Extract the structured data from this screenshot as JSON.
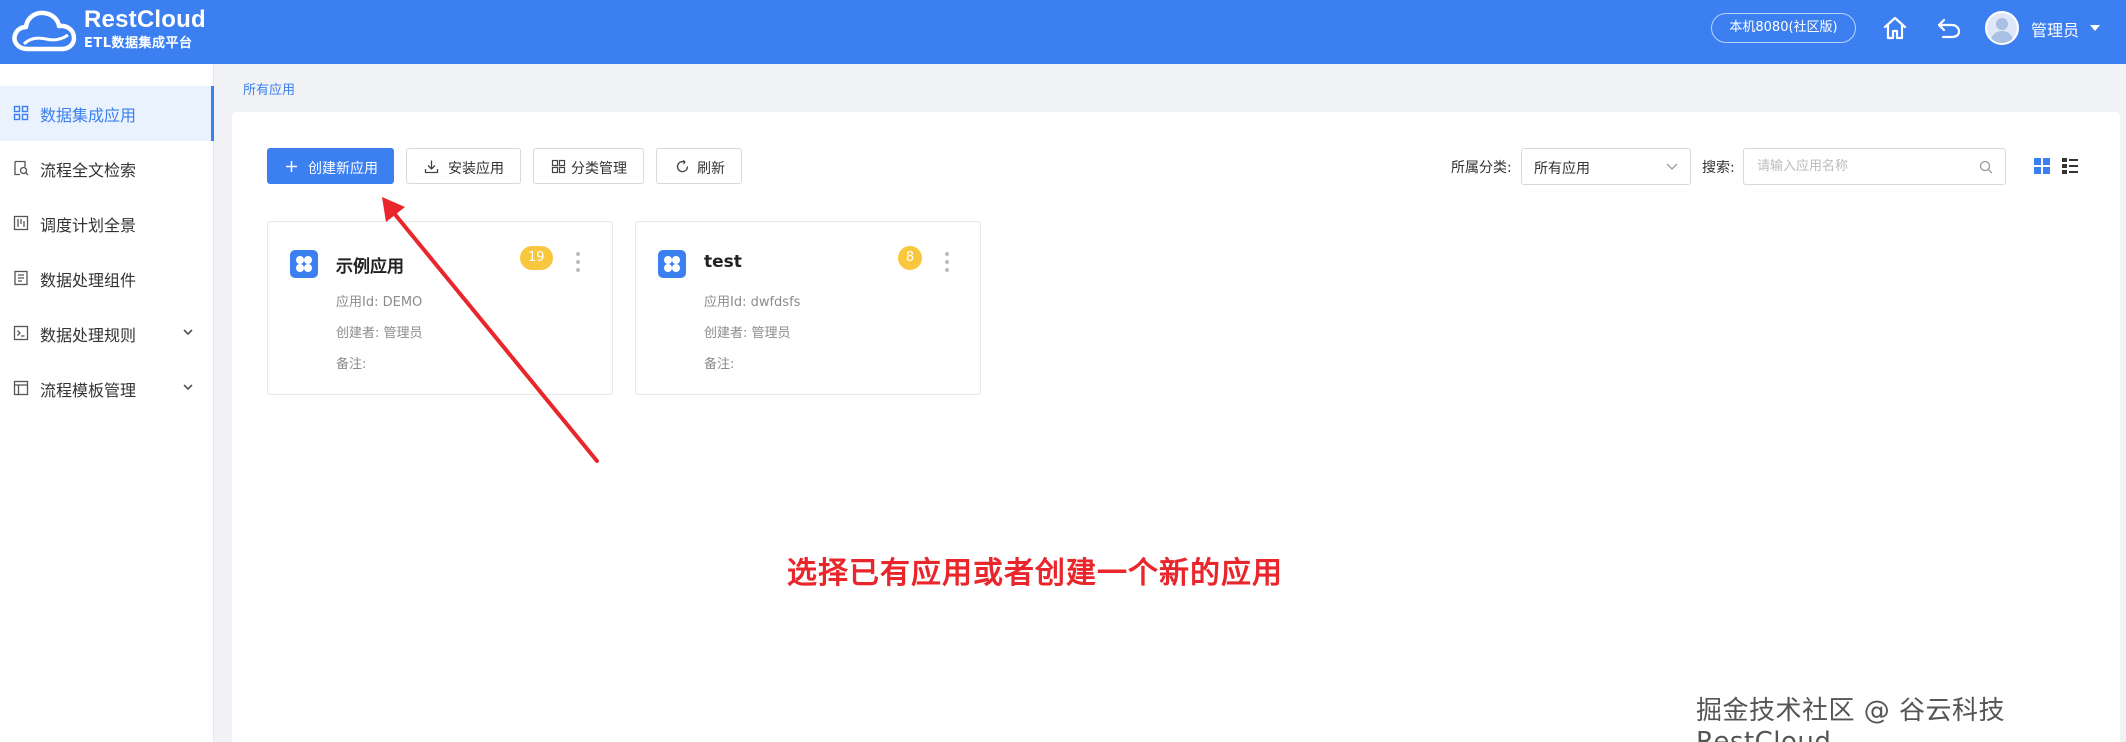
{
  "header": {
    "brand_name": "RestCloud",
    "brand_subtitle": "ETL数据集成平台",
    "env_badge": "本机8080(社区版)",
    "user_name": "管理员",
    "icons": [
      "home-icon",
      "back-icon",
      "avatar"
    ]
  },
  "sidebar": {
    "items": [
      {
        "label": "数据集成应用",
        "icon": "grid-icon",
        "active": true
      },
      {
        "label": "流程全文检索",
        "icon": "doc-search-icon"
      },
      {
        "label": "调度计划全景",
        "icon": "schedule-icon"
      },
      {
        "label": "数据处理组件",
        "icon": "component-icon"
      },
      {
        "label": "数据处理规则",
        "icon": "terminal-icon",
        "expandable": true
      },
      {
        "label": "流程模板管理",
        "icon": "template-icon",
        "expandable": true
      }
    ]
  },
  "breadcrumb": "所有应用",
  "toolbar": {
    "create_label": "创建新应用",
    "install_label": "安装应用",
    "category_label": "分类管理",
    "refresh_label": "刷新",
    "category_filter_label": "所属分类:",
    "category_value": "所有应用",
    "search_label": "搜索:",
    "search_placeholder": "请输入应用名称"
  },
  "apps": [
    {
      "name": "示例应用",
      "count": "19",
      "app_id": "应用Id: DEMO",
      "creator": "创建者: 管理员",
      "remark": "备注:"
    },
    {
      "name": "test",
      "count": "8",
      "app_id": "应用Id: dwfdsfs",
      "creator": "创建者: 管理员",
      "remark": "备注:"
    }
  ],
  "annotation": "选择已有应用或者创建一个新的应用",
  "watermark": "掘金技术社区 @ 谷云科技RestCloud",
  "colors": {
    "primary": "#3b7ff0",
    "badge": "#f9c73d",
    "annotation": "#e8262b"
  }
}
